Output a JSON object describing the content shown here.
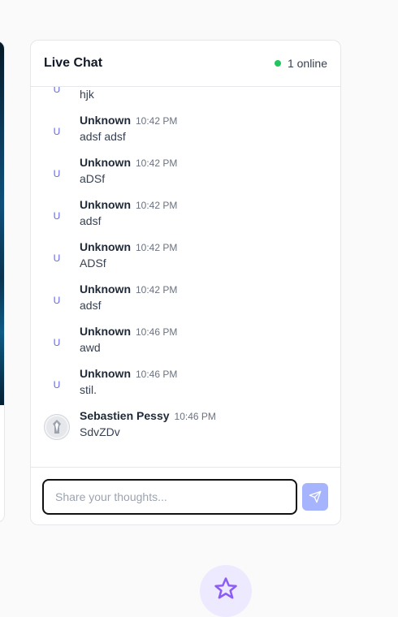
{
  "chat": {
    "title": "Live Chat",
    "online_status": "1 online",
    "status_color": "#22c55e",
    "messages": [
      {
        "avatar": "U",
        "name": "",
        "time": "",
        "text": "hjk"
      },
      {
        "avatar": "U",
        "name": "Unknown",
        "time": "10:42 PM",
        "text": "adsf adsf"
      },
      {
        "avatar": "U",
        "name": "Unknown",
        "time": "10:42 PM",
        "text": "aDSf"
      },
      {
        "avatar": "U",
        "name": "Unknown",
        "time": "10:42 PM",
        "text": "adsf"
      },
      {
        "avatar": "U",
        "name": "Unknown",
        "time": "10:42 PM",
        "text": "ADSf"
      },
      {
        "avatar": "U",
        "name": "Unknown",
        "time": "10:42 PM",
        "text": "adsf"
      },
      {
        "avatar": "U",
        "name": "Unknown",
        "time": "10:46 PM",
        "text": "awd"
      },
      {
        "avatar": "U",
        "name": "Unknown",
        "time": "10:46 PM",
        "text": "stil."
      },
      {
        "avatar": "photo",
        "name": "Sebastien Pessy",
        "time": "10:46 PM",
        "text": "SdvZDv"
      }
    ],
    "input": {
      "placeholder": "Share your thoughts...",
      "value": ""
    },
    "send_icon": "send-icon"
  },
  "accent_color": "#6366f1",
  "fab_icon": "star-icon"
}
